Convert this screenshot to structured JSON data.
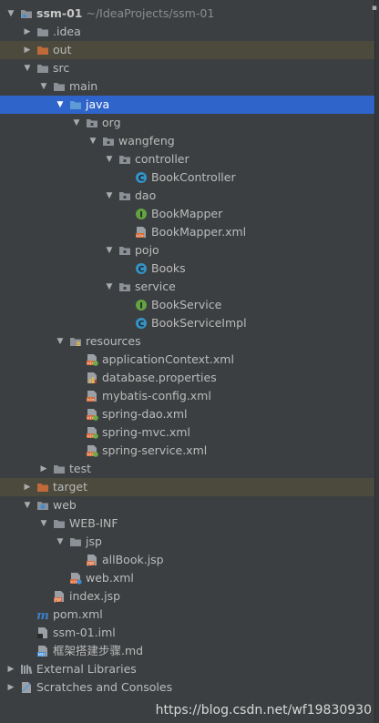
{
  "project": {
    "name": "ssm-01",
    "path": "~/IdeaProjects/ssm-01"
  },
  "tree": [
    {
      "label": "ssm-01",
      "icon": "module-folder-icon",
      "arrow": "open",
      "indent": 0,
      "bold": true,
      "path": "~/IdeaProjects/ssm-01"
    },
    {
      "label": ".idea",
      "icon": "folder-icon",
      "arrow": "closed",
      "indent": 1
    },
    {
      "label": "out",
      "icon": "excluded-folder-icon",
      "arrow": "closed",
      "indent": 1,
      "state": "excluded"
    },
    {
      "label": "src",
      "icon": "folder-icon",
      "arrow": "open",
      "indent": 1
    },
    {
      "label": "main",
      "icon": "folder-icon",
      "arrow": "open",
      "indent": 2
    },
    {
      "label": "java",
      "icon": "source-folder-icon",
      "arrow": "open",
      "indent": 3,
      "state": "selected"
    },
    {
      "label": "org",
      "icon": "package-icon",
      "arrow": "open",
      "indent": 4
    },
    {
      "label": "wangfeng",
      "icon": "package-icon",
      "arrow": "open",
      "indent": 5
    },
    {
      "label": "controller",
      "icon": "package-icon",
      "arrow": "open",
      "indent": 6
    },
    {
      "label": "BookController",
      "icon": "class-icon",
      "arrow": "none",
      "indent": 7
    },
    {
      "label": "dao",
      "icon": "package-icon",
      "arrow": "open",
      "indent": 6
    },
    {
      "label": "BookMapper",
      "icon": "interface-icon",
      "arrow": "none",
      "indent": 7
    },
    {
      "label": "BookMapper.xml",
      "icon": "xml-file-icon",
      "arrow": "none",
      "indent": 7
    },
    {
      "label": "pojo",
      "icon": "package-icon",
      "arrow": "open",
      "indent": 6
    },
    {
      "label": "Books",
      "icon": "class-icon",
      "arrow": "none",
      "indent": 7
    },
    {
      "label": "service",
      "icon": "package-icon",
      "arrow": "open",
      "indent": 6
    },
    {
      "label": "BookService",
      "icon": "interface-icon",
      "arrow": "none",
      "indent": 7
    },
    {
      "label": "BookServiceImpl",
      "icon": "class-icon",
      "arrow": "none",
      "indent": 7
    },
    {
      "label": "resources",
      "icon": "resources-folder-icon",
      "arrow": "open",
      "indent": 3
    },
    {
      "label": "applicationContext.xml",
      "icon": "spring-xml-icon",
      "arrow": "none",
      "indent": 4
    },
    {
      "label": "database.properties",
      "icon": "properties-file-icon",
      "arrow": "none",
      "indent": 4
    },
    {
      "label": "mybatis-config.xml",
      "icon": "xml-file-icon",
      "arrow": "none",
      "indent": 4
    },
    {
      "label": "spring-dao.xml",
      "icon": "spring-xml-icon",
      "arrow": "none",
      "indent": 4
    },
    {
      "label": "spring-mvc.xml",
      "icon": "spring-xml-icon",
      "arrow": "none",
      "indent": 4
    },
    {
      "label": "spring-service.xml",
      "icon": "spring-xml-icon",
      "arrow": "none",
      "indent": 4
    },
    {
      "label": "test",
      "icon": "folder-icon",
      "arrow": "closed",
      "indent": 2
    },
    {
      "label": "target",
      "icon": "excluded-folder-icon",
      "arrow": "closed",
      "indent": 1,
      "state": "excluded"
    },
    {
      "label": "web",
      "icon": "web-folder-icon",
      "arrow": "open",
      "indent": 1
    },
    {
      "label": "WEB-INF",
      "icon": "folder-icon",
      "arrow": "open",
      "indent": 2
    },
    {
      "label": "jsp",
      "icon": "folder-icon",
      "arrow": "open",
      "indent": 3
    },
    {
      "label": "allBook.jsp",
      "icon": "jsp-file-icon",
      "arrow": "none",
      "indent": 4
    },
    {
      "label": "web.xml",
      "icon": "web-xml-icon",
      "arrow": "none",
      "indent": 3
    },
    {
      "label": "index.jsp",
      "icon": "jsp-file-icon",
      "arrow": "none",
      "indent": 2
    },
    {
      "label": "pom.xml",
      "icon": "maven-icon",
      "arrow": "none",
      "indent": 1
    },
    {
      "label": "ssm-01.iml",
      "icon": "iml-file-icon",
      "arrow": "none",
      "indent": 1
    },
    {
      "label": "框架搭建步骤.md",
      "icon": "markdown-file-icon",
      "arrow": "none",
      "indent": 1
    },
    {
      "label": "External Libraries",
      "icon": "libraries-icon",
      "arrow": "closed",
      "indent": 0
    },
    {
      "label": "Scratches and Consoles",
      "icon": "scratches-icon",
      "arrow": "closed",
      "indent": 0
    }
  ],
  "watermark": "https://blog.csdn.net/wf19830930",
  "colors": {
    "background": "#3c3f41",
    "selected": "#2f65ca",
    "excluded": "#4b4a3d",
    "folder": "#8a9096",
    "excluded_folder": "#c06a3a",
    "source_folder": "#5d9bd4",
    "class": "#3592c4",
    "interface": "#62a342",
    "xml": "#d86b3a",
    "spring": "#6aad45"
  }
}
